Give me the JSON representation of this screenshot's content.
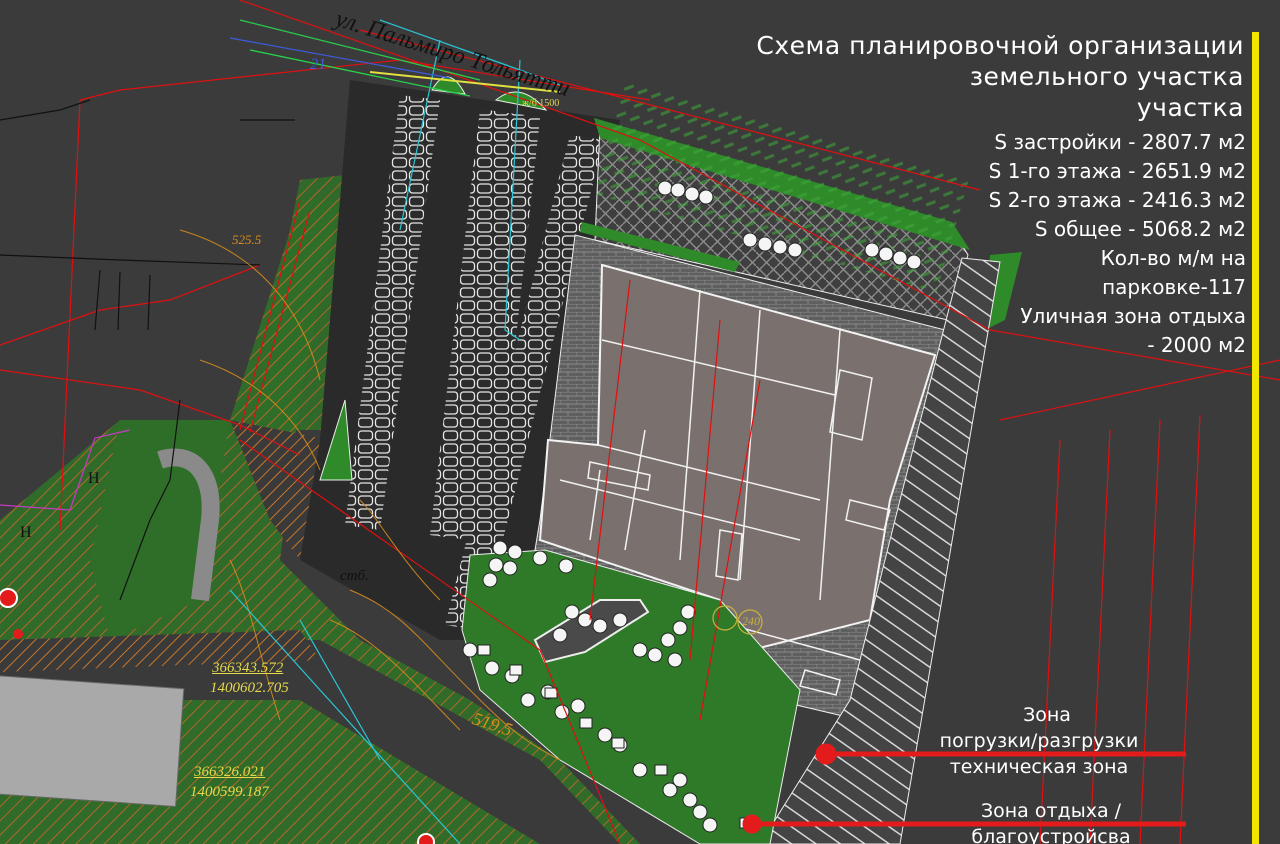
{
  "header": {
    "title_lines": [
      "Схема планировочной организации",
      "земельного участка",
      "участка"
    ]
  },
  "stats": [
    "S застройки - 2807.7 м2",
    "S 1-го этажа - 2651.9 м2",
    "S 2-го этажа - 2416.3 м2",
    "S общее - 5068.2 м2",
    "Кол-во м/м на",
    "парковке-117",
    "Уличная зона отдыха",
    "- 2000 м2"
  ],
  "zones": {
    "loading": [
      "Зона",
      "погрузки/разгрузки",
      "техническая зона"
    ],
    "rest": [
      "Зона отдыха /",
      "благоустройсва"
    ]
  },
  "cad_labels": {
    "street": "ул. Пальмиро Тольятти",
    "coord1_a": "366343.572",
    "coord1_b": "1400602.705",
    "coord2_a": "366326.021",
    "coord2_b": "1400599.187",
    "elev_1": "519.5",
    "elev_2": "525.5",
    "mark_240": "240",
    "mark_stb": "стб.",
    "mark_zh": "ж/б 1500",
    "mark_21": "21",
    "mark_n1": "Н",
    "mark_n2": "Н"
  },
  "colors": {
    "background": "#3b3b3b",
    "green_area": "#2f7d2a",
    "hatch_orange": "#c8762a",
    "brick_paving": "#5e5e5e",
    "building": "#7a716e",
    "road": "#2a2a2a",
    "red_lines": "#e01010",
    "zone_marker": "#e41b1b",
    "accent_bar": "#f2e600"
  }
}
